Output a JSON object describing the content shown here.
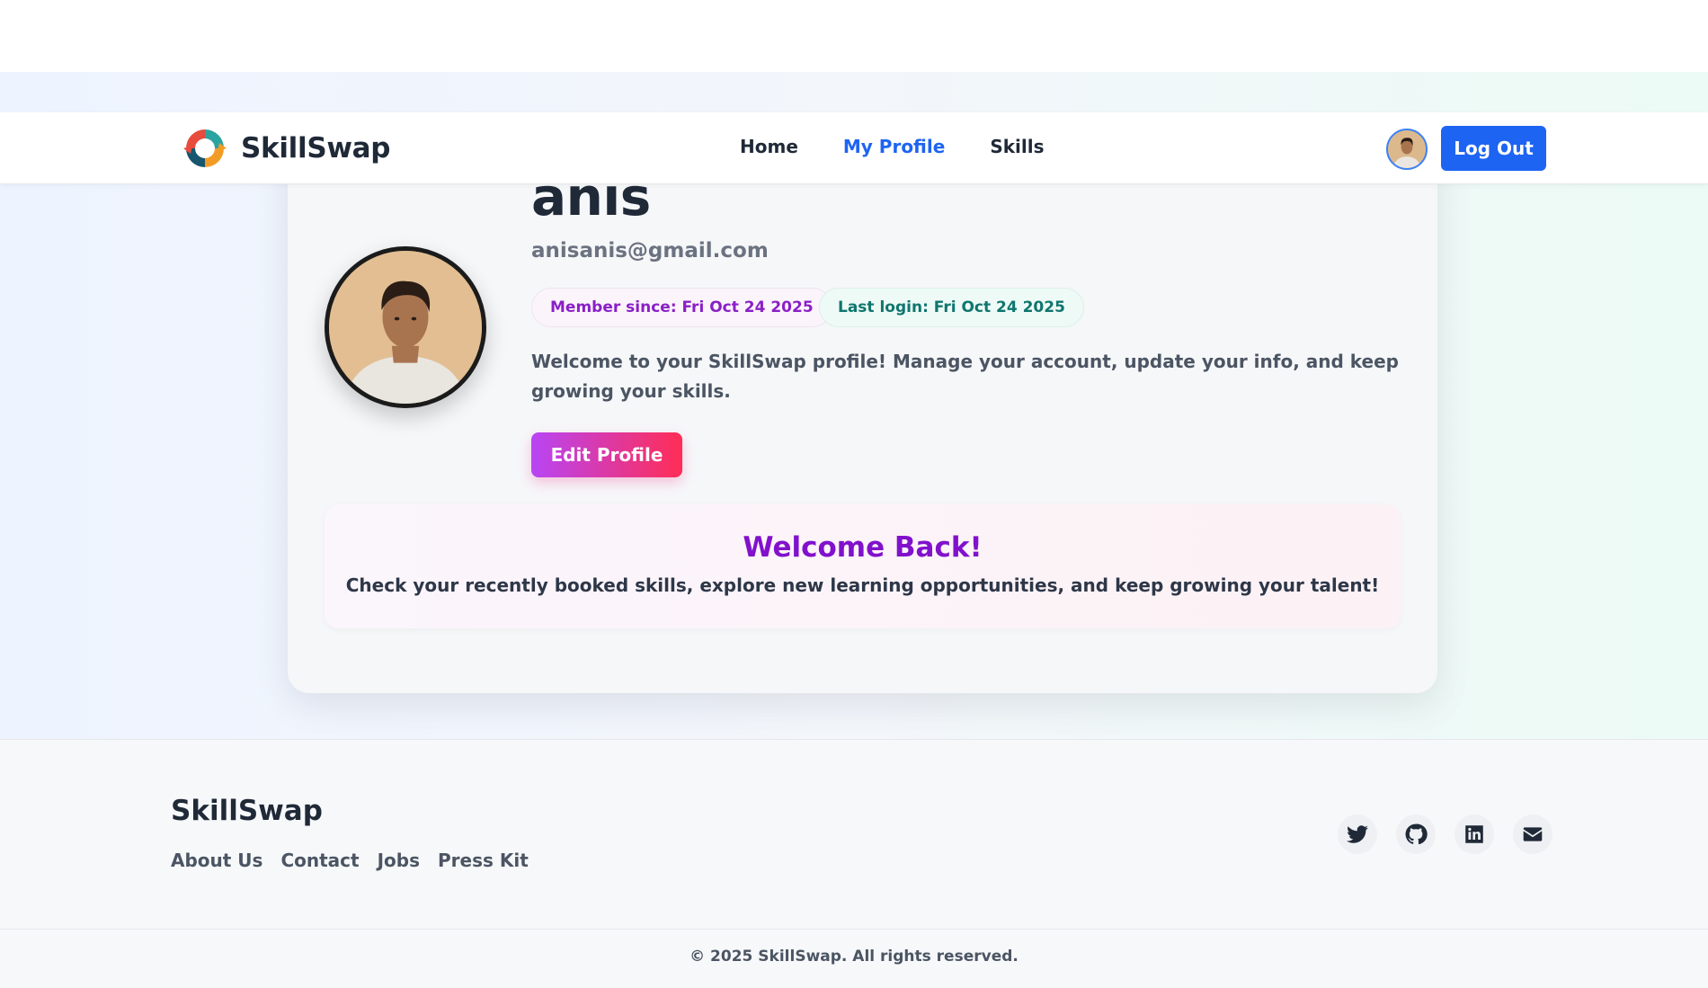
{
  "nav": {
    "brand": "SkillSwap",
    "links": [
      {
        "label": "Home",
        "active": false
      },
      {
        "label": "My Profile",
        "active": true
      },
      {
        "label": "Skills",
        "active": false
      }
    ],
    "logout_label": "Log Out",
    "accent_color": "#1d64f2"
  },
  "profile": {
    "name": "anis",
    "email": "anisanis@gmail.com",
    "member_since": "Member since: Fri Oct 24 2025",
    "last_login": "Last login: Fri Oct 24 2025",
    "intro": "Welcome to your SkillSwap profile! Manage your account, update your info, and keep growing your skills.",
    "edit_label": "Edit Profile"
  },
  "welcome": {
    "title": "Welcome Back!",
    "text": "Check your recently booked skills, explore new learning opportunities, and keep growing your talent!"
  },
  "footer": {
    "brand": "SkillSwap",
    "links": [
      "About Us",
      "Contact",
      "Jobs",
      "Press Kit"
    ],
    "social_icons": [
      "twitter-icon",
      "github-icon",
      "linkedin-icon",
      "mail-icon"
    ],
    "copyright": "© 2025 SkillSwap. All rights reserved."
  }
}
